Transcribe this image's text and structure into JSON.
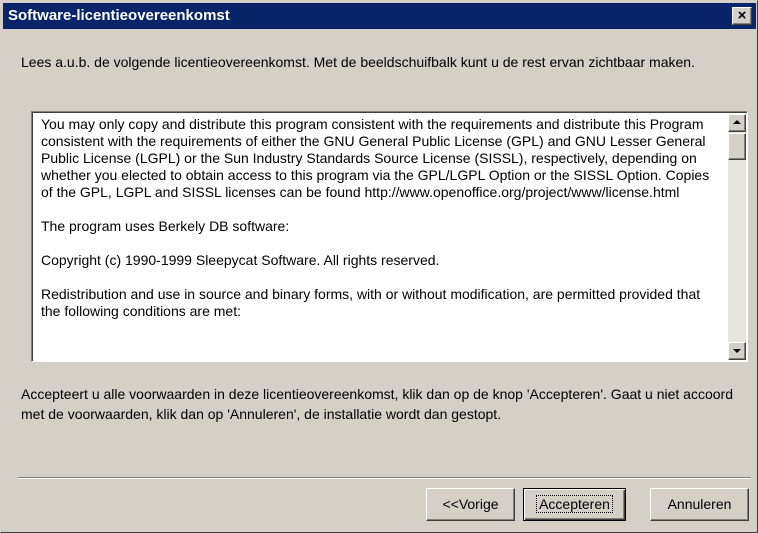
{
  "window": {
    "title": "Software-licentieovereenkomst",
    "close_glyph": "×"
  },
  "intro_text": "Lees a.u.b. de volgende licentieovereenkomst. Met de beeldschuifbalk  kunt u de rest ervan zichtbaar maken.",
  "license": {
    "paragraphs": [
      "You may only copy and distribute this program consistent with the requirements and distribute this Program consistent with the requirements of either the GNU General Public License (GPL) and GNU Lesser General Public License (LGPL) or the Sun Industry Standards Source License (SISSL), respectively, depending on whether you elected to obtain access to this program via the GPL/LGPL Option or the SISSL Option. Copies of the GPL, LGPL and SISSL licenses can be found http://www.openoffice.org/project/www/license.html",
      "The program uses Berkely DB software:",
      "Copyright (c) 1990-1999 Sleepycat Software.  All rights reserved.",
      "Redistribution and use in source and binary forms, with or without modification, are permitted provided that the following conditions are met:"
    ]
  },
  "question_text": "Accepteert u alle voorwaarden in deze licentieovereenkomst, klik dan op de knop 'Accepteren'. Gaat u niet accoord met de voorwaarden, klik dan op 'Annuleren', de installatie wordt dan gestopt.",
  "buttons": {
    "prev": "<<Vorige",
    "accept": "Accepteren",
    "cancel": "Annuleren"
  },
  "colors": {
    "titlebar": "#0a246a",
    "face": "#d4d0c8"
  },
  "icons": {
    "close": "close-icon",
    "scroll_up": "arrow-up-icon",
    "scroll_down": "arrow-down-icon"
  }
}
